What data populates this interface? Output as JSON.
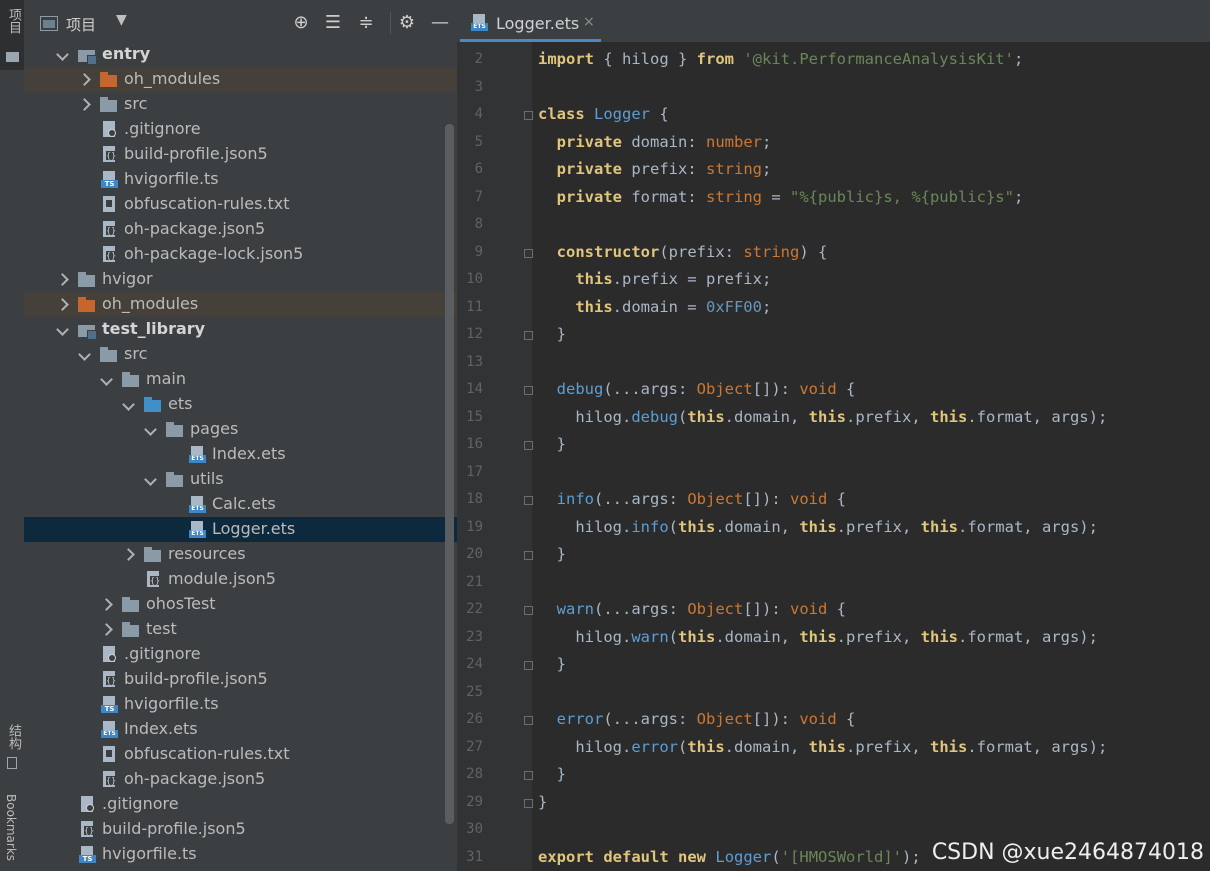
{
  "sidebar_strip": {
    "project_label": "项目",
    "structure_label": "结构",
    "bookmarks_label": "Bookmarks"
  },
  "project_panel": {
    "title": "项目",
    "toolbar_icons": [
      "locate-icon",
      "expand-all-icon",
      "collapse-all-icon",
      "gear-icon",
      "minimize-icon"
    ]
  },
  "tree": [
    {
      "label": "entry",
      "icon": "module",
      "bold": true,
      "expanded": true
    },
    {
      "label": "oh_modules",
      "icon": "folder-orange",
      "expanded": false,
      "highlight": true
    },
    {
      "label": "src",
      "icon": "folder",
      "expanded": false
    },
    {
      "label": ".gitignore",
      "icon": "git"
    },
    {
      "label": "build-profile.json5",
      "icon": "json"
    },
    {
      "label": "hvigorfile.ts",
      "icon": "ts"
    },
    {
      "label": "obfuscation-rules.txt",
      "icon": "file"
    },
    {
      "label": "oh-package.json5",
      "icon": "json"
    },
    {
      "label": "oh-package-lock.json5",
      "icon": "json"
    },
    {
      "label": "hvigor",
      "icon": "folder",
      "expanded": false
    },
    {
      "label": "oh_modules",
      "icon": "folder-orange",
      "expanded": false,
      "highlight": true
    },
    {
      "label": "test_library",
      "icon": "module",
      "bold": true,
      "expanded": true
    },
    {
      "label": "src",
      "icon": "folder",
      "expanded": true
    },
    {
      "label": "main",
      "icon": "folder",
      "expanded": true
    },
    {
      "label": "ets",
      "icon": "folder-blue",
      "expanded": true
    },
    {
      "label": "pages",
      "icon": "folder",
      "expanded": true
    },
    {
      "label": "Index.ets",
      "icon": "ets"
    },
    {
      "label": "utils",
      "icon": "folder",
      "expanded": true
    },
    {
      "label": "Calc.ets",
      "icon": "ets"
    },
    {
      "label": "Logger.ets",
      "icon": "ets",
      "selected": true
    },
    {
      "label": "resources",
      "icon": "folder",
      "expanded": false
    },
    {
      "label": "module.json5",
      "icon": "json"
    },
    {
      "label": "ohosTest",
      "icon": "folder",
      "expanded": false
    },
    {
      "label": "test",
      "icon": "folder",
      "expanded": false
    },
    {
      "label": ".gitignore",
      "icon": "git"
    },
    {
      "label": "build-profile.json5",
      "icon": "json"
    },
    {
      "label": "hvigorfile.ts",
      "icon": "ts"
    },
    {
      "label": "Index.ets",
      "icon": "ets"
    },
    {
      "label": "obfuscation-rules.txt",
      "icon": "file"
    },
    {
      "label": "oh-package.json5",
      "icon": "json"
    },
    {
      "label": ".gitignore",
      "icon": "git"
    },
    {
      "label": "build-profile.json5",
      "icon": "json"
    },
    {
      "label": "hvigorfile.ts",
      "icon": "ts"
    }
  ],
  "tab": {
    "label": "Logger.ets",
    "close": "×"
  },
  "code_lines": [
    {
      "n": "2",
      "tokens": [
        [
          "kw2",
          "import"
        ],
        [
          "plain",
          " { "
        ],
        [
          "plain",
          "hilog"
        ],
        [
          "plain",
          " } "
        ],
        [
          "kw2",
          "from"
        ],
        [
          "plain",
          " "
        ],
        [
          "str",
          "'@kit.PerformanceAnalysisKit'"
        ],
        [
          "plain",
          ";"
        ]
      ]
    },
    {
      "n": "3",
      "tokens": []
    },
    {
      "n": "4",
      "tokens": [
        [
          "kw2",
          "class"
        ],
        [
          "plain",
          " "
        ],
        [
          "cls",
          "Logger"
        ],
        [
          "plain",
          " {"
        ]
      ]
    },
    {
      "n": "5",
      "tokens": [
        [
          "plain",
          "  "
        ],
        [
          "kw2",
          "private"
        ],
        [
          "plain",
          " domain: "
        ],
        [
          "typ",
          "number"
        ],
        [
          "plain",
          ";"
        ]
      ]
    },
    {
      "n": "6",
      "tokens": [
        [
          "plain",
          "  "
        ],
        [
          "kw2",
          "private"
        ],
        [
          "plain",
          " prefix: "
        ],
        [
          "typ",
          "string"
        ],
        [
          "plain",
          ";"
        ]
      ]
    },
    {
      "n": "7",
      "tokens": [
        [
          "plain",
          "  "
        ],
        [
          "kw2",
          "private"
        ],
        [
          "plain",
          " format: "
        ],
        [
          "typ",
          "string"
        ],
        [
          "plain",
          " = "
        ],
        [
          "str",
          "\"%{public}s, %{public}s\""
        ],
        [
          "plain",
          ";"
        ]
      ]
    },
    {
      "n": "8",
      "tokens": []
    },
    {
      "n": "9",
      "tokens": [
        [
          "plain",
          "  "
        ],
        [
          "kw2",
          "constructor"
        ],
        [
          "plain",
          "(prefix: "
        ],
        [
          "typ",
          "string"
        ],
        [
          "plain",
          ") {"
        ]
      ]
    },
    {
      "n": "10",
      "tokens": [
        [
          "plain",
          "    "
        ],
        [
          "kw2",
          "this"
        ],
        [
          "plain",
          ".prefix = prefix;"
        ]
      ]
    },
    {
      "n": "11",
      "tokens": [
        [
          "plain",
          "    "
        ],
        [
          "kw2",
          "this"
        ],
        [
          "plain",
          ".domain = "
        ],
        [
          "num",
          "0xFF00"
        ],
        [
          "plain",
          ";"
        ]
      ]
    },
    {
      "n": "12",
      "tokens": [
        [
          "plain",
          "  }"
        ]
      ]
    },
    {
      "n": "13",
      "tokens": []
    },
    {
      "n": "14",
      "tokens": [
        [
          "plain",
          "  "
        ],
        [
          "fn",
          "debug"
        ],
        [
          "plain",
          "(...args: "
        ],
        [
          "typ",
          "Object"
        ],
        [
          "plain",
          "[]): "
        ],
        [
          "typ",
          "void"
        ],
        [
          "plain",
          " {"
        ]
      ]
    },
    {
      "n": "15",
      "tokens": [
        [
          "plain",
          "    hilog."
        ],
        [
          "fn",
          "debug"
        ],
        [
          "plain",
          "("
        ],
        [
          "kw2",
          "this"
        ],
        [
          "plain",
          ".domain, "
        ],
        [
          "kw2",
          "this"
        ],
        [
          "plain",
          ".prefix, "
        ],
        [
          "kw2",
          "this"
        ],
        [
          "plain",
          ".format, args);"
        ]
      ]
    },
    {
      "n": "16",
      "tokens": [
        [
          "plain",
          "  }"
        ]
      ]
    },
    {
      "n": "17",
      "tokens": []
    },
    {
      "n": "18",
      "tokens": [
        [
          "plain",
          "  "
        ],
        [
          "fn",
          "info"
        ],
        [
          "plain",
          "(...args: "
        ],
        [
          "typ",
          "Object"
        ],
        [
          "plain",
          "[]): "
        ],
        [
          "typ",
          "void"
        ],
        [
          "plain",
          " {"
        ]
      ]
    },
    {
      "n": "19",
      "tokens": [
        [
          "plain",
          "    hilog."
        ],
        [
          "fn",
          "info"
        ],
        [
          "plain",
          "("
        ],
        [
          "kw2",
          "this"
        ],
        [
          "plain",
          ".domain, "
        ],
        [
          "kw2",
          "this"
        ],
        [
          "plain",
          ".prefix, "
        ],
        [
          "kw2",
          "this"
        ],
        [
          "plain",
          ".format, args);"
        ]
      ]
    },
    {
      "n": "20",
      "tokens": [
        [
          "plain",
          "  }"
        ]
      ]
    },
    {
      "n": "21",
      "tokens": []
    },
    {
      "n": "22",
      "tokens": [
        [
          "plain",
          "  "
        ],
        [
          "fn",
          "warn"
        ],
        [
          "plain",
          "(...args: "
        ],
        [
          "typ",
          "Object"
        ],
        [
          "plain",
          "[]): "
        ],
        [
          "typ",
          "void"
        ],
        [
          "plain",
          " {"
        ]
      ]
    },
    {
      "n": "23",
      "tokens": [
        [
          "plain",
          "    hilog."
        ],
        [
          "fn",
          "warn"
        ],
        [
          "plain",
          "("
        ],
        [
          "kw2",
          "this"
        ],
        [
          "plain",
          ".domain, "
        ],
        [
          "kw2",
          "this"
        ],
        [
          "plain",
          ".prefix, "
        ],
        [
          "kw2",
          "this"
        ],
        [
          "plain",
          ".format, args);"
        ]
      ]
    },
    {
      "n": "24",
      "tokens": [
        [
          "plain",
          "  }"
        ]
      ]
    },
    {
      "n": "25",
      "tokens": []
    },
    {
      "n": "26",
      "tokens": [
        [
          "plain",
          "  "
        ],
        [
          "fn",
          "error"
        ],
        [
          "plain",
          "(...args: "
        ],
        [
          "typ",
          "Object"
        ],
        [
          "plain",
          "[]): "
        ],
        [
          "typ",
          "void"
        ],
        [
          "plain",
          " {"
        ]
      ]
    },
    {
      "n": "27",
      "tokens": [
        [
          "plain",
          "    hilog."
        ],
        [
          "fn",
          "error"
        ],
        [
          "plain",
          "("
        ],
        [
          "kw2",
          "this"
        ],
        [
          "plain",
          ".domain, "
        ],
        [
          "kw2",
          "this"
        ],
        [
          "plain",
          ".prefix, "
        ],
        [
          "kw2",
          "this"
        ],
        [
          "plain",
          ".format, args);"
        ]
      ]
    },
    {
      "n": "28",
      "tokens": [
        [
          "plain",
          "  }"
        ]
      ]
    },
    {
      "n": "29",
      "tokens": [
        [
          "plain",
          "}"
        ]
      ]
    },
    {
      "n": "30",
      "tokens": []
    },
    {
      "n": "31",
      "tokens": [
        [
          "kw2",
          "export"
        ],
        [
          "plain",
          " "
        ],
        [
          "kw2",
          "default"
        ],
        [
          "plain",
          " "
        ],
        [
          "kw2",
          "new"
        ],
        [
          "plain",
          " "
        ],
        [
          "cls",
          "Logger"
        ],
        [
          "plain",
          "("
        ],
        [
          "str",
          "'[HMOSWorld]'"
        ],
        [
          "plain",
          ");"
        ]
      ]
    }
  ],
  "watermark": "CSDN @xue2464874018",
  "colors": {
    "selection": "#0d293e",
    "highlight_row": "#45413a",
    "accent": "#4a88c7"
  }
}
